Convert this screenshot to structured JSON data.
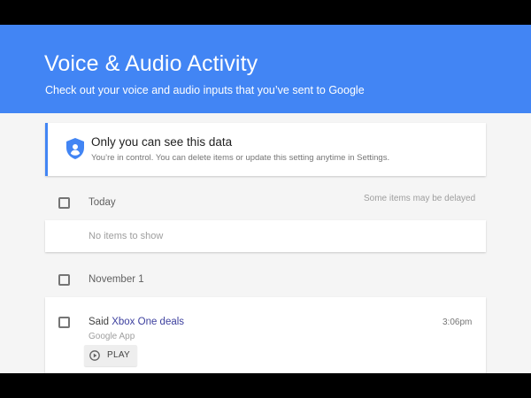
{
  "header": {
    "title": "Voice & Audio Activity",
    "subtitle": "Check out your voice and audio inputs that you’ve sent to Google",
    "color": "#4285f4"
  },
  "notice": {
    "icon": "shield-user-icon",
    "title": "Only you can see this data",
    "text": "You’re in control. You can delete items or update this setting anytime in Settings."
  },
  "groups": [
    {
      "date": "Today",
      "note": "Some items may be delayed",
      "empty_text": "No items to show"
    },
    {
      "date": "November 1",
      "items": [
        {
          "prefix": "Said ",
          "query": "Xbox One deals",
          "time": "3:06pm",
          "app": "Google App",
          "play_label": "PLAY",
          "play_icon": "play-circle-icon"
        }
      ]
    }
  ]
}
